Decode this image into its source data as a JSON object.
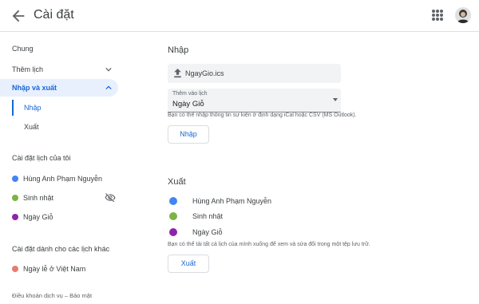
{
  "header": {
    "title": "Cài đặt",
    "back_icon": "arrow-back-icon",
    "apps_icon": "apps-grid-icon",
    "avatar": "user-avatar"
  },
  "sidebar": {
    "items": [
      {
        "label": "Chung"
      },
      {
        "label": "Thêm lịch"
      },
      {
        "label": "Nhập và xuất"
      }
    ],
    "sub_items": [
      {
        "label": "Nhập"
      },
      {
        "label": "Xuất"
      }
    ],
    "my_calendars": {
      "heading": "Cài đặt lịch của tôi",
      "items": [
        {
          "label": "Hùng Anh Phạm Nguyễn",
          "color": "#4285f4"
        },
        {
          "label": "Sinh nhật",
          "color": "#7cb342"
        },
        {
          "label": "Ngày Giỗ",
          "color": "#8e24aa"
        }
      ]
    },
    "other_calendars": {
      "heading": "Cài đặt dành cho các lịch khác",
      "items": [
        {
          "label": "Ngày lễ ở Việt Nam",
          "color": "#e67c73"
        }
      ]
    },
    "footer": "Điều khoản dịch vụ – Bảo mật"
  },
  "import": {
    "heading": "Nhập",
    "file_name": "NgayGio.ics",
    "select_label": "Thêm vào lịch",
    "select_value": "Ngày Giỗ",
    "help": "Bạn có thể nhập thông tin sự kiện ở định dạng iCal hoặc CSV (MS Outlook).",
    "button": "Nhập"
  },
  "export": {
    "heading": "Xuất",
    "items": [
      {
        "label": "Hùng Anh Phạm Nguyễn",
        "color": "#4285f4"
      },
      {
        "label": "Sinh nhật",
        "color": "#7cb342"
      },
      {
        "label": "Ngày Giỗ",
        "color": "#8e24aa"
      }
    ],
    "help": "Bạn có thể tải tất cả lịch của mình xuống để xem và sửa đổi trong một tệp lưu trữ.",
    "button": "Xuất"
  },
  "colors": {
    "accent": "#1967d2",
    "active_bg": "#e8f0fe"
  }
}
